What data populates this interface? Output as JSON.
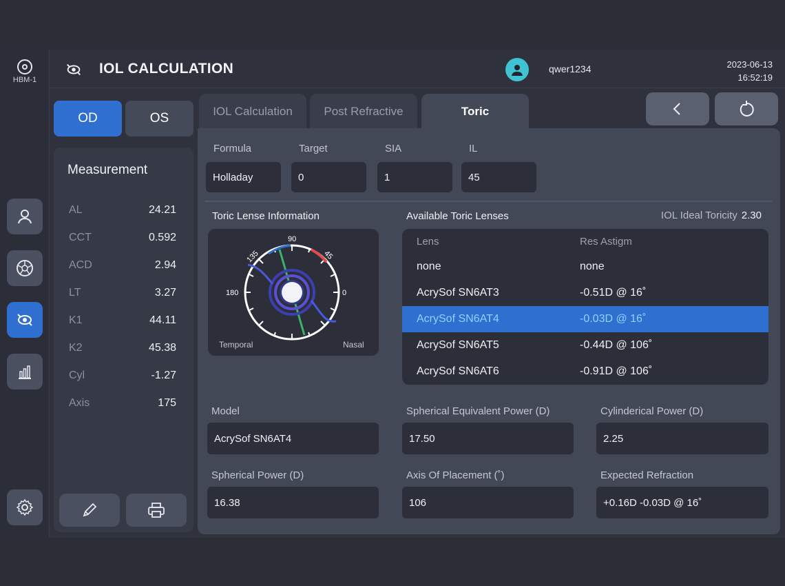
{
  "brand": {
    "label": "HBM-1"
  },
  "header": {
    "title": "IOL CALCULATION",
    "user": "qwer1234",
    "date": "2023-06-13",
    "time": "16:52:19"
  },
  "eye": {
    "od_label": "OD",
    "os_label": "OS",
    "selected": "OD"
  },
  "measurement": {
    "title": "Measurement",
    "rows": [
      {
        "label": "AL",
        "value": "24.21"
      },
      {
        "label": "CCT",
        "value": "0.592"
      },
      {
        "label": "ACD",
        "value": "2.94"
      },
      {
        "label": "LT",
        "value": "3.27"
      },
      {
        "label": "K1",
        "value": "44.11"
      },
      {
        "label": "K2",
        "value": "45.38"
      },
      {
        "label": "Cyl",
        "value": "-1.27"
      },
      {
        "label": "Axis",
        "value": "175"
      }
    ]
  },
  "tabs": [
    {
      "label": "IOL Calculation",
      "active": false
    },
    {
      "label": "Post Refractive",
      "active": false
    },
    {
      "label": "Toric",
      "active": true
    }
  ],
  "params": {
    "formula_label": "Formula",
    "formula_value": "Holladay",
    "target_label": "Target",
    "target_value": "0",
    "sia_label": "SIA",
    "sia_value": "1",
    "il_label": "IL",
    "il_value": "45"
  },
  "toric_info": {
    "title": "Toric Lense Information",
    "ticks": {
      "t90": "90",
      "t135": "135",
      "t45": "45",
      "t180": "180",
      "t0": "0"
    },
    "temporal": "Temporal",
    "nasal": "Nasal"
  },
  "lenses": {
    "title": "Available Toric Lenses",
    "ideal_label": "IOL Ideal Toricity",
    "ideal_value": "2.30",
    "col_lens": "Lens",
    "col_res": "Res Astigm",
    "rows": [
      {
        "lens": "none",
        "res": "none",
        "selected": false
      },
      {
        "lens": "AcrySof SN6AT3",
        "res": "-0.51D @ 16˚",
        "selected": false
      },
      {
        "lens": "AcrySof SN6AT4",
        "res": "-0.03D @ 16˚",
        "selected": true
      },
      {
        "lens": "AcrySof SN6AT5",
        "res": "-0.44D @ 106˚",
        "selected": false
      },
      {
        "lens": "AcrySof SN6AT6",
        "res": "-0.91D @ 106˚",
        "selected": false
      }
    ]
  },
  "results": {
    "model_label": "Model",
    "model_value": "AcrySof SN6AT4",
    "se_label": "Spherical Equivalent Power (D)",
    "se_value": "17.50",
    "cyl_label": "Cylinderical Power (D)",
    "cyl_value": "2.25",
    "sph_label": "Spherical Power (D)",
    "sph_value": "16.38",
    "axis_label": "Axis Of Placement (˚)",
    "axis_value": "106",
    "exp_label": "Expected Refraction",
    "exp_value": "+0.16D -0.03D @ 16˚"
  },
  "colors": {
    "accent": "#2f6fd0",
    "avatar": "#3fc3d1",
    "selected_text": "#8fd3ff"
  },
  "icons": {
    "rail": [
      "user-icon",
      "aperture-icon",
      "eye-lens-icon",
      "bar-chart-icon",
      "settings-gear-icon"
    ],
    "tools": [
      "pencil-icon",
      "printer-icon"
    ],
    "nav": [
      "back-chevron-icon",
      "refresh-icon"
    ]
  }
}
